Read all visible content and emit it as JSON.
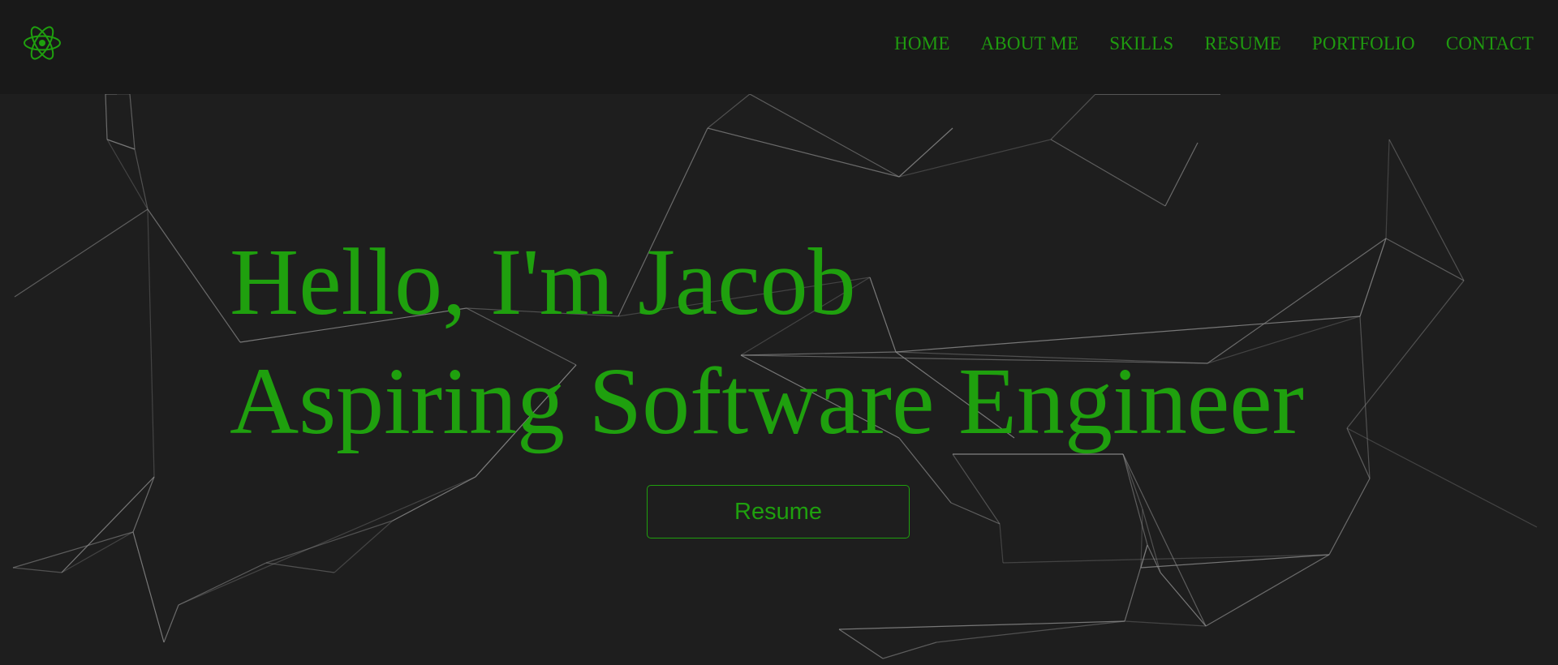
{
  "nav": {
    "logo_icon": "react-atom-icon",
    "links": [
      "HOME",
      "ABOUT ME",
      "SKILLS",
      "RESUME",
      "PORTFOLIO",
      "CONTACT"
    ]
  },
  "hero": {
    "greeting": "Hello, I'm Jacob",
    "tagline": "Aspiring Software Engineer",
    "resume_label": "Resume"
  },
  "colors": {
    "accent": "#1fa00e",
    "background": "#1e1e1e",
    "navbar": "#191919",
    "network_lines": "#8a8a8a"
  }
}
